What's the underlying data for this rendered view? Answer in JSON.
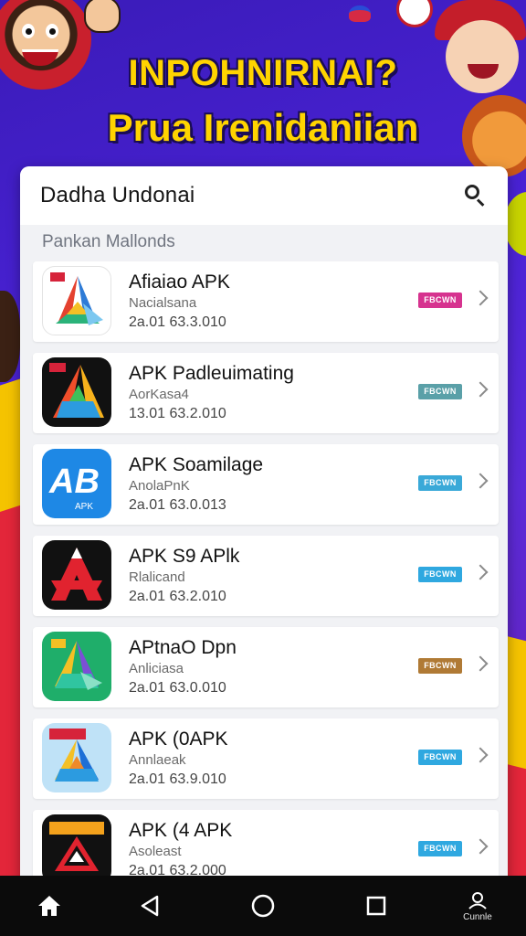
{
  "banner": {
    "line1": "INPOHNIRNAI?",
    "line2": "Prua Irenidaniian"
  },
  "card": {
    "title": "Dadha Undonai",
    "section_label": "Pankan Mallonds"
  },
  "apps": [
    {
      "name": "Afiaiao APK",
      "subtitle": "Nacialsana",
      "version": "2a.01 63.3.010",
      "badge": "FBCWN",
      "badge_color": "#d6338f",
      "icon": "colorful-a-icon",
      "icon_bg": "#ffffff"
    },
    {
      "name": "APK Padleuimating",
      "subtitle": "AorKasa4",
      "version": "13.01 63.2.010",
      "badge": "FBCWN",
      "badge_color": "#5aa0a8",
      "icon": "rainbow-a-icon",
      "icon_bg": "#111111"
    },
    {
      "name": "APK Soamilage",
      "subtitle": "AnolaPnK",
      "version": "2a.01 63.0.013",
      "badge": "FBCWN",
      "badge_color": "#3aa9d8",
      "icon": "ab-letters-icon",
      "icon_bg": "#1e88e5"
    },
    {
      "name": "APK S9 APlk",
      "subtitle": "Rlalicand",
      "version": "2a.01 63.2.010",
      "badge": "FBCWN",
      "badge_color": "#2fa8e0",
      "icon": "red-a-icon",
      "icon_bg": "#111111"
    },
    {
      "name": "APtnaO Dpn",
      "subtitle": "Anliciasa",
      "version": "2a.01 63.0.010",
      "badge": "FBCWN",
      "badge_color": "#b07a35",
      "icon": "green-a-icon",
      "icon_bg": "#1fae6a"
    },
    {
      "name": "APK (0APK",
      "subtitle": "Annlaeak",
      "version": "2a.01 63.9.010",
      "badge": "FBCWN",
      "badge_color": "#2fa8e0",
      "icon": "blue-tile-a-icon",
      "icon_bg": "#bfe2f7"
    },
    {
      "name": "APK (4 APK",
      "subtitle": "Asoleast",
      "version": "2a.01 63.2.000",
      "badge": "FBCWN",
      "badge_color": "#2fa8e0",
      "icon": "red-frame-a-icon",
      "icon_bg": "#111111"
    }
  ],
  "navbar": {
    "home_icon": "home-icon",
    "back_icon": "back-triangle-icon",
    "home_circle_icon": "circle-home-icon",
    "recents_icon": "square-recents-icon",
    "user_label": "Cunnle"
  }
}
